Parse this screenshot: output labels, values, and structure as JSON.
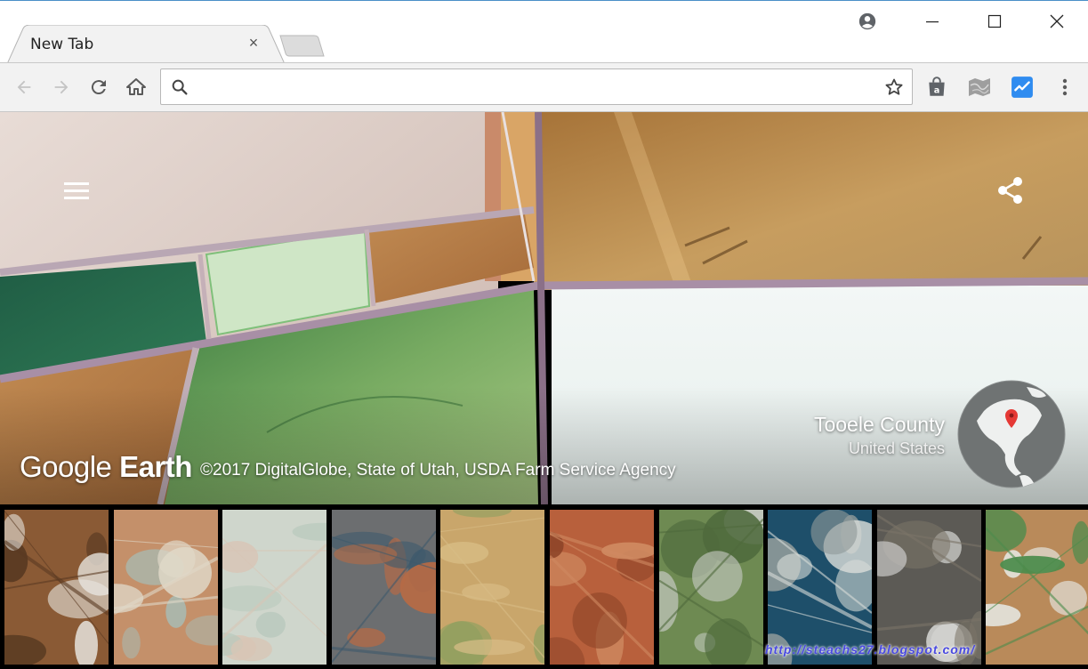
{
  "browser": {
    "tab_title": "New Tab",
    "close_glyph": "×",
    "address_value": "",
    "address_placeholder": "",
    "icons": [
      "back-icon",
      "forward-icon",
      "reload-icon",
      "home-icon",
      "search-icon",
      "star-icon",
      "shopping-bag-icon",
      "map-extension-icon",
      "checkmark-extension-icon",
      "more-icon",
      "profile-icon",
      "minimize-icon",
      "maximize-icon",
      "close-icon"
    ]
  },
  "earth": {
    "brand_light": "Google ",
    "brand_bold": "Earth",
    "copyright": "©2017 DigitalGlobe, State of Utah, USDA Farm Service Agency",
    "place_name": "Tooele County",
    "place_country": "United States"
  },
  "thumbnails": [
    {
      "name": "dunes",
      "colors": [
        "#8a5a35",
        "#e8e6e0",
        "#5a3a22"
      ]
    },
    {
      "name": "desert-lake",
      "colors": [
        "#c4906a",
        "#a9b9b0",
        "#e0d8c8"
      ]
    },
    {
      "name": "salt-ponds",
      "colors": [
        "#cfd6cc",
        "#b9c9bd",
        "#d8c6b6"
      ]
    },
    {
      "name": "industrial",
      "colors": [
        "#6c6e70",
        "#b66a45",
        "#3e5a6c"
      ]
    },
    {
      "name": "farmland",
      "colors": [
        "#c9a66b",
        "#8ea060",
        "#d8bd86"
      ]
    },
    {
      "name": "red-canyon",
      "colors": [
        "#b8603c",
        "#8e4528",
        "#d08a62"
      ]
    },
    {
      "name": "greenhouses",
      "colors": [
        "#6e8a52",
        "#c9cdc6",
        "#4f6a3c"
      ]
    },
    {
      "name": "harbor",
      "colors": [
        "#1e4f6a",
        "#8f9a9a",
        "#d8dcd8"
      ]
    },
    {
      "name": "snowy-cliffs",
      "colors": [
        "#5c5a55",
        "#d6d6d4",
        "#7b7468"
      ]
    },
    {
      "name": "salt-flats",
      "colors": [
        "#b98a5a",
        "#e9eeec",
        "#4c8c4c"
      ]
    }
  ],
  "watermark": "http://steachs27.blogspot.com/"
}
